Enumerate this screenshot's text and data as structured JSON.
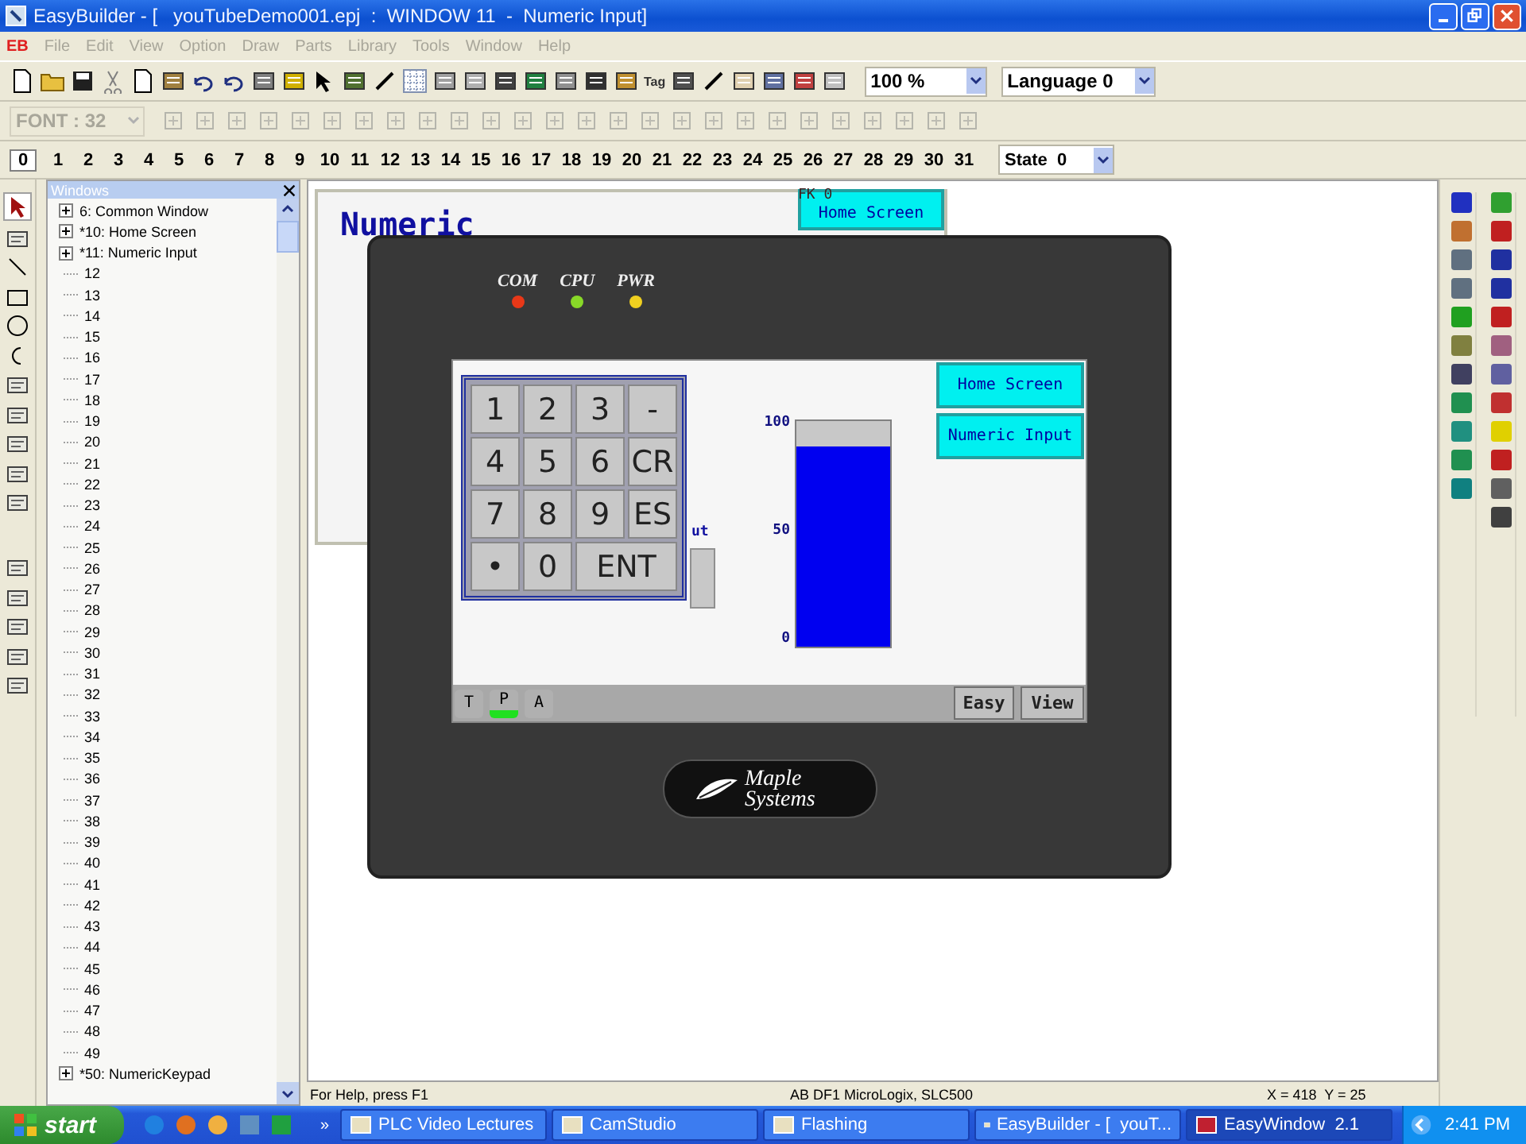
{
  "window": {
    "title": "EasyBuilder - [   youTubeDemo001.epj  :  WINDOW 11  -  Numeric Input]"
  },
  "menu": {
    "logo": "EB",
    "items": [
      {
        "label": "File",
        "disabled": true
      },
      {
        "label": "Edit",
        "disabled": true
      },
      {
        "label": "View",
        "disabled": true
      },
      {
        "label": "Option",
        "disabled": true
      },
      {
        "label": "Draw",
        "disabled": true
      },
      {
        "label": "Parts",
        "disabled": true
      },
      {
        "label": "Library",
        "disabled": true
      },
      {
        "label": "Tools",
        "disabled": true
      },
      {
        "label": "Window",
        "disabled": true
      },
      {
        "label": "Help",
        "disabled": true
      }
    ]
  },
  "toolbar": {
    "tag": "Tag",
    "zoom": "100 %",
    "language": "Language 0",
    "font": "FONT : 32",
    "font_disabled": true
  },
  "window_tabs": [
    {
      "label": "0",
      "selected": true
    },
    {
      "label": "1",
      "selected": false
    },
    {
      "label": "2",
      "selected": false
    },
    {
      "label": "3",
      "selected": false
    },
    {
      "label": "4",
      "selected": false
    },
    {
      "label": "5",
      "selected": false
    },
    {
      "label": "6",
      "selected": false
    },
    {
      "label": "7",
      "selected": false
    },
    {
      "label": "8",
      "selected": false
    },
    {
      "label": "9",
      "selected": false
    },
    {
      "label": "10",
      "selected": false
    },
    {
      "label": "11",
      "selected": false
    },
    {
      "label": "12",
      "selected": false
    },
    {
      "label": "13",
      "selected": false
    },
    {
      "label": "14",
      "selected": false
    },
    {
      "label": "15",
      "selected": false
    },
    {
      "label": "16",
      "selected": false
    },
    {
      "label": "17",
      "selected": false
    },
    {
      "label": "18",
      "selected": false
    },
    {
      "label": "19",
      "selected": false
    },
    {
      "label": "20",
      "selected": false
    },
    {
      "label": "21",
      "selected": false
    },
    {
      "label": "22",
      "selected": false
    },
    {
      "label": "23",
      "selected": false
    },
    {
      "label": "24",
      "selected": false
    },
    {
      "label": "25",
      "selected": false
    },
    {
      "label": "26",
      "selected": false
    },
    {
      "label": "27",
      "selected": false
    },
    {
      "label": "28",
      "selected": false
    },
    {
      "label": "29",
      "selected": false
    },
    {
      "label": "30",
      "selected": false
    },
    {
      "label": "31",
      "selected": false
    }
  ],
  "state": "State  0",
  "tree": {
    "title": "Windows",
    "items": [
      {
        "label": "6: Common Window",
        "kind": "folder",
        "expanded": false
      },
      {
        "label": "*10: Home Screen",
        "kind": "folder",
        "expanded": false
      },
      {
        "label": "*11: Numeric Input",
        "kind": "folder",
        "expanded": false
      },
      {
        "label": "12",
        "kind": "leaf"
      },
      {
        "label": "13",
        "kind": "leaf"
      },
      {
        "label": "14",
        "kind": "leaf"
      },
      {
        "label": "15",
        "kind": "leaf"
      },
      {
        "label": "16",
        "kind": "leaf"
      },
      {
        "label": "17",
        "kind": "leaf"
      },
      {
        "label": "18",
        "kind": "leaf"
      },
      {
        "label": "19",
        "kind": "leaf"
      },
      {
        "label": "20",
        "kind": "leaf"
      },
      {
        "label": "21",
        "kind": "leaf"
      },
      {
        "label": "22",
        "kind": "leaf"
      },
      {
        "label": "23",
        "kind": "leaf"
      },
      {
        "label": "24",
        "kind": "leaf"
      },
      {
        "label": "25",
        "kind": "leaf"
      },
      {
        "label": "26",
        "kind": "leaf"
      },
      {
        "label": "27",
        "kind": "leaf"
      },
      {
        "label": "28",
        "kind": "leaf"
      },
      {
        "label": "29",
        "kind": "leaf"
      },
      {
        "label": "30",
        "kind": "leaf"
      },
      {
        "label": "31",
        "kind": "leaf"
      },
      {
        "label": "32",
        "kind": "leaf"
      },
      {
        "label": "33",
        "kind": "leaf"
      },
      {
        "label": "34",
        "kind": "leaf"
      },
      {
        "label": "35",
        "kind": "leaf"
      },
      {
        "label": "36",
        "kind": "leaf"
      },
      {
        "label": "37",
        "kind": "leaf"
      },
      {
        "label": "38",
        "kind": "leaf"
      },
      {
        "label": "39",
        "kind": "leaf"
      },
      {
        "label": "40",
        "kind": "leaf"
      },
      {
        "label": "41",
        "kind": "leaf"
      },
      {
        "label": "42",
        "kind": "leaf"
      },
      {
        "label": "43",
        "kind": "leaf"
      },
      {
        "label": "44",
        "kind": "leaf"
      },
      {
        "label": "45",
        "kind": "leaf"
      },
      {
        "label": "46",
        "kind": "leaf"
      },
      {
        "label": "47",
        "kind": "leaf"
      },
      {
        "label": "48",
        "kind": "leaf"
      },
      {
        "label": "49",
        "kind": "leaf"
      },
      {
        "label": "*50: NumericKeypad",
        "kind": "folder",
        "expanded": false
      }
    ]
  },
  "editor": {
    "title": "Numeric",
    "fk_label": "FK 0",
    "button": "Home Screen"
  },
  "device": {
    "leds": [
      {
        "label": "COM",
        "color": "#e83818"
      },
      {
        "label": "CPU",
        "color": "#88d828"
      },
      {
        "label": "PWR",
        "color": "#f0d020"
      }
    ],
    "brand": "Maple Systems"
  },
  "screen": {
    "keypad": [
      {
        "label": "1",
        "kind": "key"
      },
      {
        "label": "2",
        "kind": "key"
      },
      {
        "label": "3",
        "kind": "key"
      },
      {
        "label": "-",
        "kind": "key"
      },
      {
        "label": "4",
        "kind": "key"
      },
      {
        "label": "5",
        "kind": "key"
      },
      {
        "label": "6",
        "kind": "key"
      },
      {
        "label": "CR",
        "kind": "key"
      },
      {
        "label": "7",
        "kind": "key"
      },
      {
        "label": "8",
        "kind": "key"
      },
      {
        "label": "9",
        "kind": "key"
      },
      {
        "label": "ES",
        "kind": "key"
      },
      {
        "label": "•",
        "kind": "key"
      },
      {
        "label": "0",
        "kind": "key"
      },
      {
        "label": "ENT",
        "kind": "wide"
      }
    ],
    "covered_label": "ut",
    "meter": {
      "level": 0.89,
      "ticks": [
        "100",
        "50",
        "0"
      ]
    },
    "buttons": [
      "Home Screen",
      "Numeric Input"
    ],
    "indicators": [
      {
        "label": "T",
        "on": false
      },
      {
        "label": "P",
        "on": true
      },
      {
        "label": "A",
        "on": false
      }
    ],
    "footer_buttons": [
      "Easy",
      "View"
    ]
  },
  "status_bar": [
    "For Help, press F1",
    "AB DF1 MicroLogix, SLC500",
    "X = 418  Y = 25"
  ],
  "taskbar": {
    "start": "start",
    "overflow": "»",
    "tasks": [
      {
        "label": "PLC Video Lectures",
        "selected": false
      },
      {
        "label": "CamStudio",
        "selected": false
      },
      {
        "label": "Flashing",
        "selected": false
      },
      {
        "label": "EasyBuilder - [  youT...",
        "selected": false
      },
      {
        "label": "EasyWindow  2.1",
        "selected": true
      }
    ],
    "clock": "2:41 PM"
  }
}
